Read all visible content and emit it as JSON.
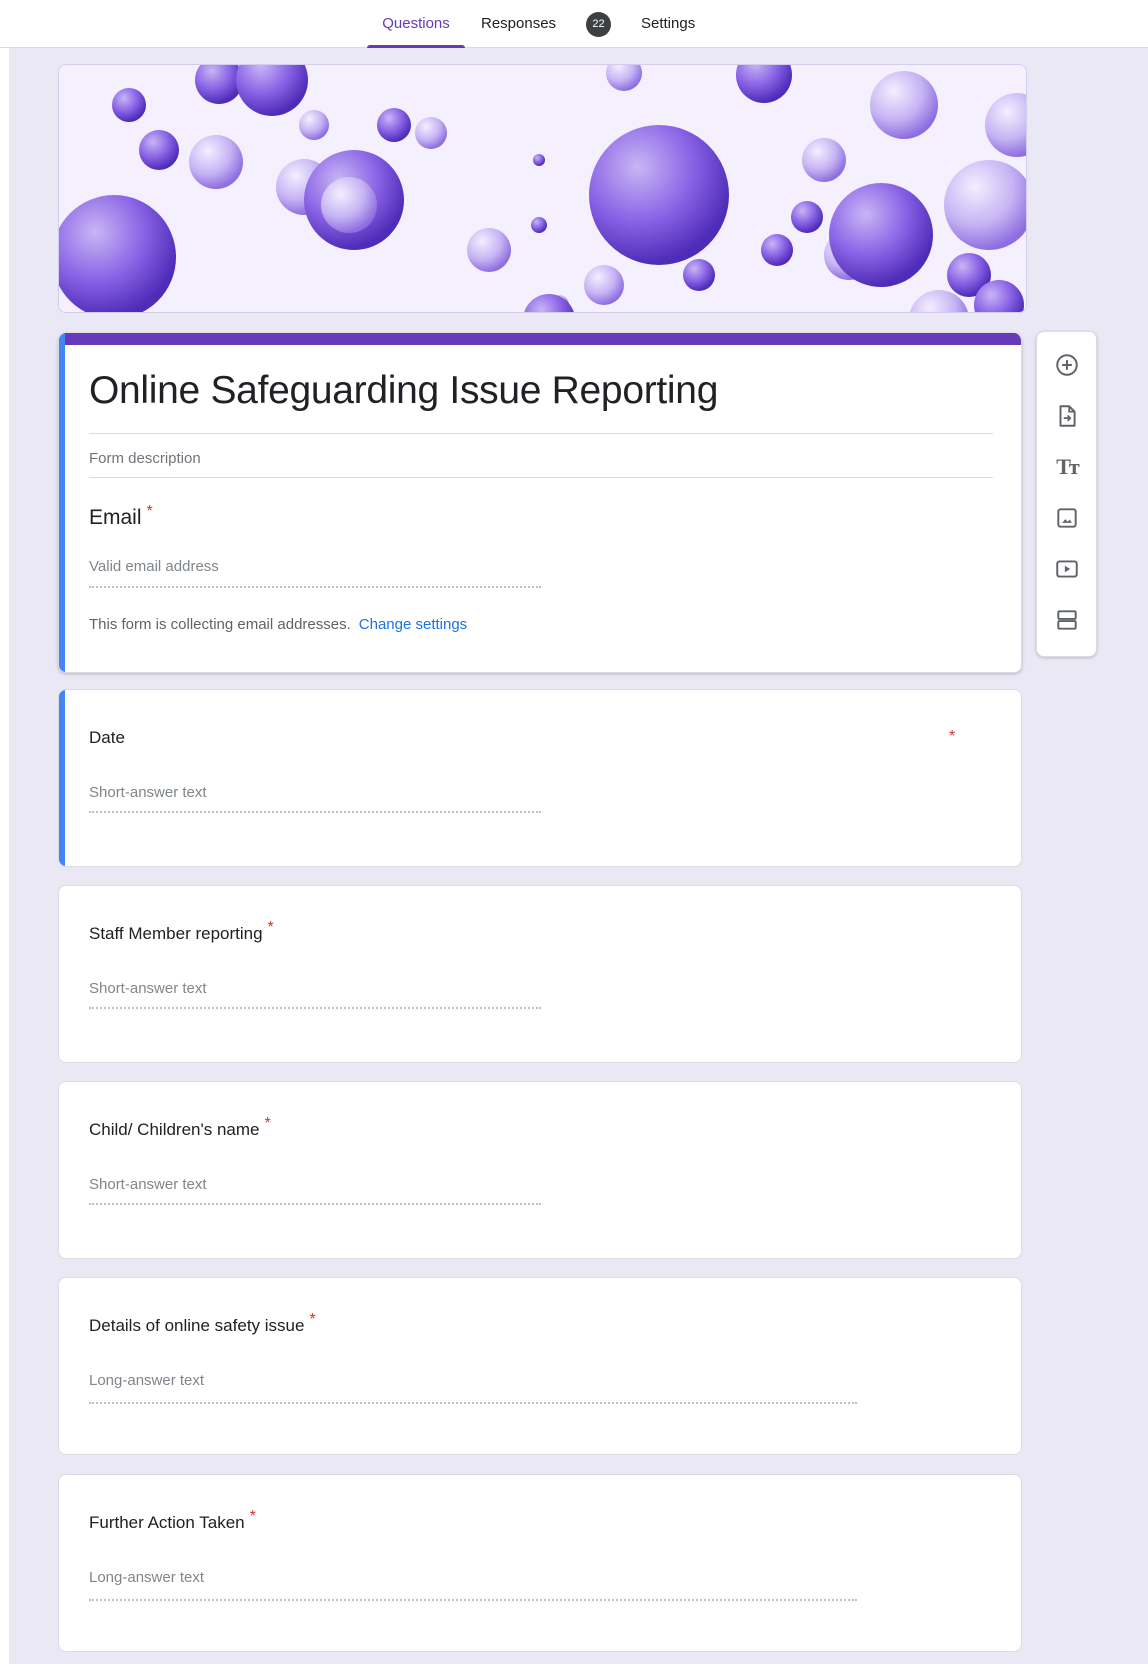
{
  "tabs": {
    "questions": "Questions",
    "responses": "Responses",
    "responses_count": "22",
    "settings": "Settings"
  },
  "form": {
    "title": "Online Safeguarding Issue Reporting",
    "description_placeholder": "Form description",
    "email_label": "Email",
    "email_hint": "Valid email address",
    "collect_note": "This form is collecting email addresses.",
    "change_settings": "Change settings",
    "required_mark": "*"
  },
  "questions": [
    {
      "title": "Date",
      "hint": "Short-answer text"
    },
    {
      "title": "Staff Member reporting",
      "hint": "Short-answer text"
    },
    {
      "title": "Child/ Children's name",
      "hint": "Short-answer text"
    },
    {
      "title": "Details of online safety issue",
      "hint": "Long-answer text"
    },
    {
      "title": "Further Action Taken",
      "hint": "Long-answer text"
    }
  ],
  "toolbar": [
    "add-question-icon",
    "import-questions-icon",
    "add-title-icon",
    "add-image-icon",
    "add-video-icon",
    "add-section-icon"
  ],
  "colors": {
    "accent": "#673ab7",
    "active_card": "#4285f4",
    "background": "#ebe8f6",
    "required": "#d93025",
    "link": "#1a73e8"
  }
}
